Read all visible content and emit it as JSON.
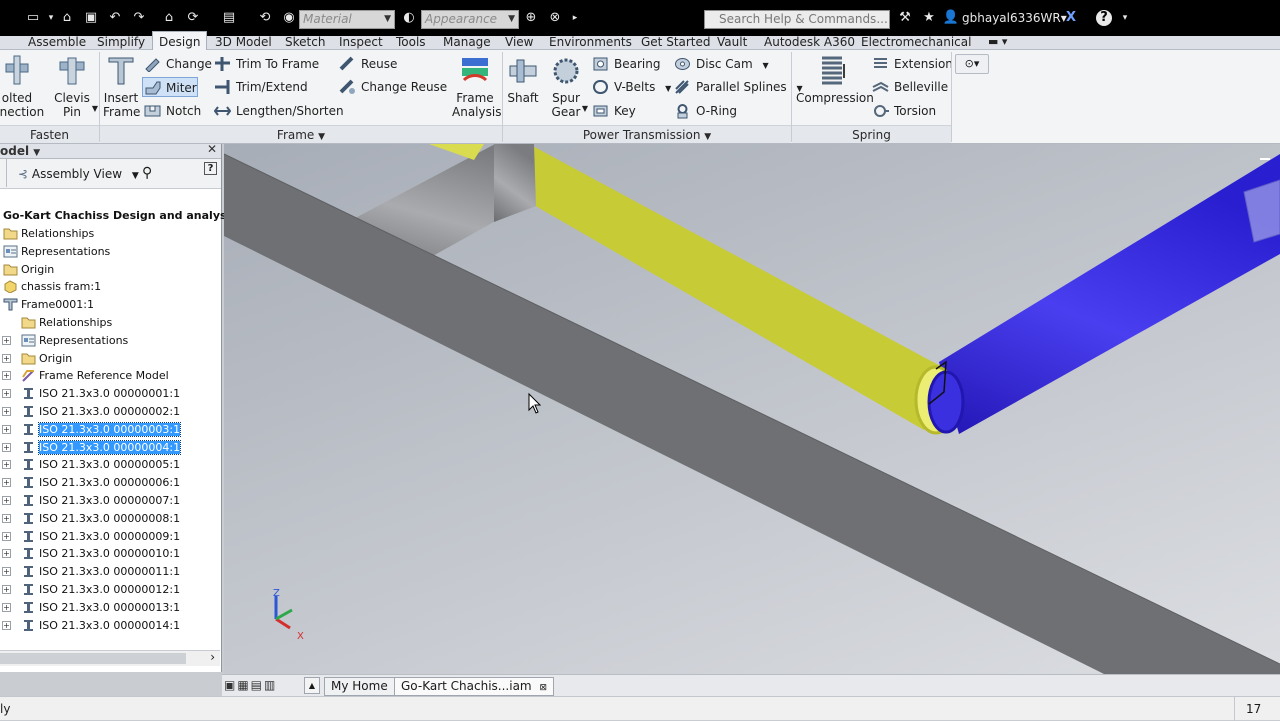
{
  "qat": {
    "material_placeholder": "Material",
    "appearance_placeholder": "Appearance",
    "search_placeholder": "Search Help & Commands...",
    "user": "gbhayal6336WR",
    "user_caret": "▾"
  },
  "ribbon_tabs": [
    "Assemble",
    "Simplify",
    "Design",
    "3D Model",
    "Sketch",
    "Inspect",
    "Tools",
    "Manage",
    "View",
    "Environments",
    "Get Started",
    "Vault",
    "Autodesk A360",
    "Electromechanical"
  ],
  "active_tab": "Design",
  "ribbon": {
    "fasten": {
      "label": "Fasten",
      "bolted_l1": "olted",
      "bolted_l2": "nnection",
      "clevis_l1": "Clevis",
      "clevis_l2": "Pin"
    },
    "frame": {
      "label": "Frame",
      "insert_l1": "Insert",
      "insert_l2": "Frame",
      "change": "Change",
      "miter": "Miter",
      "notch": "Notch",
      "trim_to_frame": "Trim To Frame",
      "trim_extend": "Trim/Extend",
      "lengthen_shorten": "Lengthen/Shorten",
      "reuse": "Reuse",
      "change_reuse": "Change Reuse",
      "analysis_l1": "Frame",
      "analysis_l2": "Analysis"
    },
    "power": {
      "label": "Power Transmission",
      "shaft": "Shaft",
      "spur_l1": "Spur",
      "spur_l2": "Gear",
      "bearing": "Bearing",
      "vbelts": "V-Belts",
      "key": "Key",
      "disc_cam": "Disc Cam",
      "parallel_splines": "Parallel Splines",
      "oring": "O-Ring"
    },
    "spring": {
      "label": "Spring",
      "compression": "Compression",
      "extension": "Extension",
      "belleville": "Belleville",
      "torsion": "Torsion"
    }
  },
  "browser": {
    "title": "odel",
    "view_mode": "Assembly View",
    "root": "Go-Kart Chachiss Design and analysis.ia",
    "items": [
      {
        "label": "Relationships",
        "icon": "folder",
        "level": 0,
        "expander": false,
        "selected": false
      },
      {
        "label": "Representations",
        "icon": "representations",
        "level": 0,
        "expander": false,
        "selected": false
      },
      {
        "label": "Origin",
        "icon": "folder",
        "level": 0,
        "expander": false,
        "selected": false
      },
      {
        "label": "chassis fram:1",
        "icon": "part",
        "level": 0,
        "expander": false,
        "selected": false
      },
      {
        "label": "Frame0001:1",
        "icon": "frame",
        "level": 0,
        "expander": false,
        "selected": false
      },
      {
        "label": "Relationships",
        "icon": "folder",
        "level": 1,
        "expander": false,
        "selected": false
      },
      {
        "label": "Representations",
        "icon": "representations",
        "level": 1,
        "expander": true,
        "selected": false
      },
      {
        "label": "Origin",
        "icon": "folder",
        "level": 1,
        "expander": true,
        "selected": false
      },
      {
        "label": "Frame Reference Model",
        "icon": "reference",
        "level": 1,
        "expander": true,
        "selected": false
      },
      {
        "label": "ISO 21.3x3.0 00000001:1",
        "icon": "ibeam",
        "level": 1,
        "expander": true,
        "selected": false
      },
      {
        "label": "ISO 21.3x3.0 00000002:1",
        "icon": "ibeam",
        "level": 1,
        "expander": true,
        "selected": false
      },
      {
        "label": "ISO 21.3x3.0 00000003:1",
        "icon": "ibeam",
        "level": 1,
        "expander": true,
        "selected": true
      },
      {
        "label": "ISO 21.3x3.0 00000004:1",
        "icon": "ibeam",
        "level": 1,
        "expander": true,
        "selected": true
      },
      {
        "label": "ISO 21.3x3.0 00000005:1",
        "icon": "ibeam",
        "level": 1,
        "expander": true,
        "selected": false
      },
      {
        "label": "ISO 21.3x3.0 00000006:1",
        "icon": "ibeam",
        "level": 1,
        "expander": true,
        "selected": false
      },
      {
        "label": "ISO 21.3x3.0 00000007:1",
        "icon": "ibeam",
        "level": 1,
        "expander": true,
        "selected": false
      },
      {
        "label": "ISO 21.3x3.0 00000008:1",
        "icon": "ibeam",
        "level": 1,
        "expander": true,
        "selected": false
      },
      {
        "label": "ISO 21.3x3.0 00000009:1",
        "icon": "ibeam",
        "level": 1,
        "expander": true,
        "selected": false
      },
      {
        "label": "ISO 21.3x3.0 00000010:1",
        "icon": "ibeam",
        "level": 1,
        "expander": true,
        "selected": false
      },
      {
        "label": "ISO 21.3x3.0 00000011:1",
        "icon": "ibeam",
        "level": 1,
        "expander": true,
        "selected": false
      },
      {
        "label": "ISO 21.3x3.0 00000012:1",
        "icon": "ibeam",
        "level": 1,
        "expander": true,
        "selected": false
      },
      {
        "label": "ISO 21.3x3.0 00000013:1",
        "icon": "ibeam",
        "level": 1,
        "expander": true,
        "selected": false
      },
      {
        "label": "ISO 21.3x3.0 00000014:1",
        "icon": "ibeam",
        "level": 1,
        "expander": true,
        "selected": false
      }
    ]
  },
  "viewport": {
    "axis_z": "Z",
    "axis_x": "X",
    "colors": {
      "gray_tube": "#8d8f92",
      "yellow_tube": "#e7ea55",
      "blue_tube": "#3d32e2"
    }
  },
  "doc_tabs": {
    "home": "My Home",
    "active": "Go-Kart Chachis...iam"
  },
  "status": {
    "left": "ly",
    "right": "17"
  }
}
